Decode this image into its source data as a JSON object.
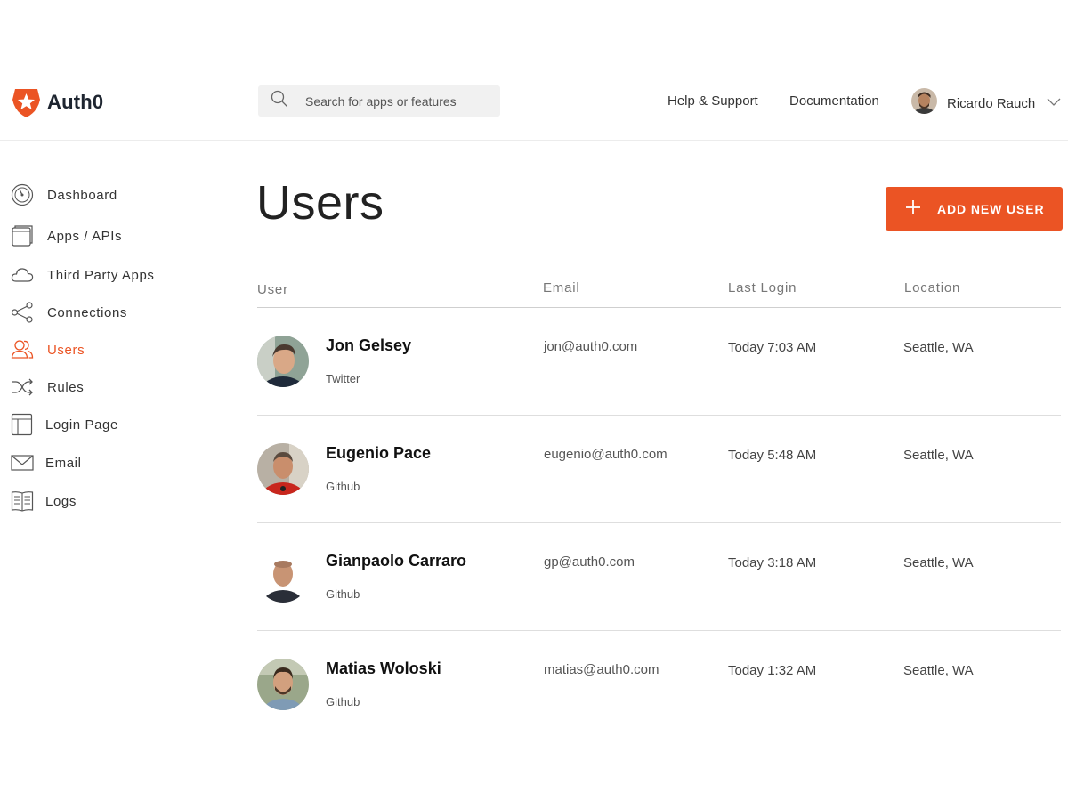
{
  "brand": {
    "name": "Auth0",
    "accent": "#eb5424"
  },
  "search": {
    "placeholder": "Search for apps or features"
  },
  "header": {
    "links": [
      "Help & Support",
      "Documentation"
    ],
    "user_name": "Ricardo Rauch"
  },
  "sidebar": {
    "items": [
      {
        "label": "Dashboard",
        "icon": "speedometer-icon",
        "active": false
      },
      {
        "label": "Apps / APIs",
        "icon": "windows-icon",
        "active": false
      },
      {
        "label": "Third Party Apps",
        "icon": "cloud-icon",
        "active": false
      },
      {
        "label": "Connections",
        "icon": "share-nodes-icon",
        "active": false
      },
      {
        "label": "Users",
        "icon": "users-icon",
        "active": true
      },
      {
        "label": "Rules",
        "icon": "shuffle-icon",
        "active": false
      },
      {
        "label": "Login Page",
        "icon": "layout-icon",
        "active": false
      },
      {
        "label": "Email",
        "icon": "envelope-icon",
        "active": false
      },
      {
        "label": "Logs",
        "icon": "book-icon",
        "active": false
      }
    ]
  },
  "main": {
    "title": "Users",
    "add_button_label": "ADD NEW USER",
    "columns": [
      "User",
      "Email",
      "Last Login",
      "Location"
    ],
    "users": [
      {
        "name": "Jon Gelsey",
        "connection": "Twitter",
        "email": "jon@auth0.com",
        "last_login": "Today 7:03 AM",
        "location": "Seattle, WA"
      },
      {
        "name": "Eugenio Pace",
        "connection": "Github",
        "email": "eugenio@auth0.com",
        "last_login": "Today 5:48 AM",
        "location": "Seattle, WA"
      },
      {
        "name": "Gianpaolo Carraro",
        "connection": "Github",
        "email": "gp@auth0.com",
        "last_login": "Today 3:18 AM",
        "location": "Seattle, WA"
      },
      {
        "name": "Matias Woloski",
        "connection": "Github",
        "email": "matias@auth0.com",
        "last_login": "Today 1:32 AM",
        "location": "Seattle, WA"
      }
    ]
  }
}
